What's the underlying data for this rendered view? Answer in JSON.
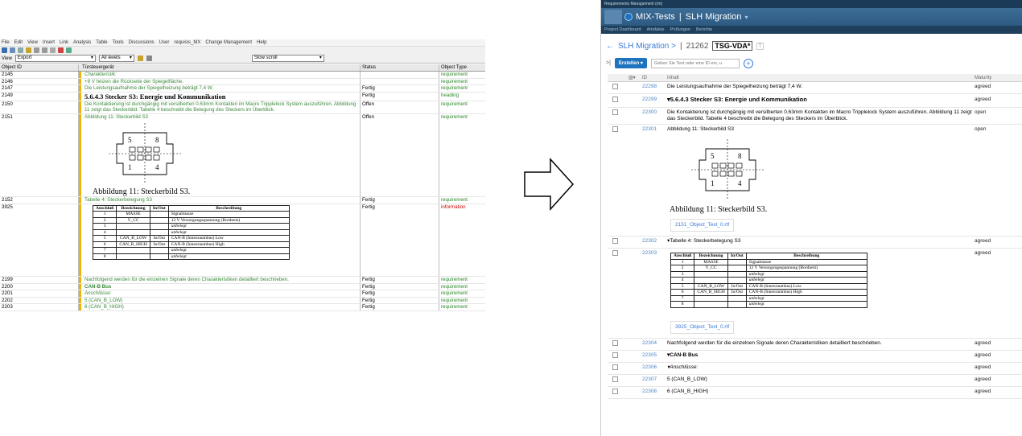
{
  "doors": {
    "menu": [
      "File",
      "Edit",
      "View",
      "Insert",
      "Link",
      "Analysis",
      "Table",
      "Tools",
      "Discussions",
      "User",
      "requisis_MX",
      "Change Management",
      "Help"
    ],
    "view_label": "View",
    "view_value": "Export",
    "levels_value": "All levels",
    "scroll_value": "Slow scroll",
    "columns": {
      "id": "Object ID",
      "main": "Türsteuergerät",
      "status": "Status",
      "type": "Object Type"
    },
    "rows": [
      {
        "id": "2145",
        "text": "Charakteristik:",
        "status": "",
        "type": "requirement",
        "style": "ital"
      },
      {
        "id": "2146",
        "text": "+8 V heizen die Rückseite der Spiegelfläche.",
        "status": "",
        "type": "requirement",
        "style": ""
      },
      {
        "id": "2147",
        "text": "Die Leistungsaufnahme der Spiegelheizung beträgt 7,4 W.",
        "status": "Fertig",
        "type": "requirement",
        "style": ""
      },
      {
        "id": "2149",
        "text": "5.6.4.3 Stecker S3: Energie und Kommunikation",
        "status": "Fertig",
        "type": "heading",
        "style": "head"
      },
      {
        "id": "2150",
        "text": "Die Kontaktierung ist durchgängig mit versilberten 0.63mm Kontakten im Macro Tripplelock System auszuführen. Abbildung 11 zeigt das Steckerbild. Tabelle 4 beschreibt die Belegung des Steckers im Überblick.",
        "status": "Offen",
        "type": "requirement",
        "style": ""
      },
      {
        "id": "2151",
        "text": "Abbildung 11: Steckerbild S3",
        "status": "Offen",
        "type": "requirement",
        "style": "figure"
      },
      {
        "id": "2152",
        "text": "Tabelle 4: Steckerbelegung S3",
        "status": "Fertig",
        "type": "requirement",
        "style": ""
      },
      {
        "id": "3925",
        "text": "",
        "status": "Fertig",
        "type": "information",
        "style": "table"
      },
      {
        "id": "2199",
        "text": "Nachfolgend werden für die einzelnen Signale deren Charakteristiken detailliert beschrieben.",
        "status": "Fertig",
        "type": "requirement",
        "style": ""
      },
      {
        "id": "2200",
        "text": "CAN-B Bus",
        "status": "Fertig",
        "type": "requirement",
        "style": "bold"
      },
      {
        "id": "2201",
        "text": "Anschlüsse:",
        "status": "Fertig",
        "type": "requirement",
        "style": "ital"
      },
      {
        "id": "2202",
        "text": "5 (CAN_B_LOW)",
        "status": "Fertig",
        "type": "requirement",
        "style": ""
      },
      {
        "id": "2203",
        "text": "6 (CAN_B_HIGH)",
        "status": "Fertig",
        "type": "requirement",
        "style": ""
      }
    ],
    "figure_caption": "Abbildung 11: Steckerbild S3."
  },
  "spec_table": {
    "headers": [
      "Anschluß",
      "Bezeichnung",
      "In/Out",
      "Beschreibung"
    ],
    "rows": [
      [
        "1",
        "MASSE",
        "",
        "Signalmasse"
      ],
      [
        "2",
        "V_CC",
        "",
        "12 V Versorgungsspannung (Bordnetz)"
      ],
      [
        "3",
        "",
        "",
        "unbelegt"
      ],
      [
        "4",
        "",
        "",
        "unbelegt"
      ],
      [
        "5",
        "CAN_B_LOW",
        "In/Out",
        "CAN-B (Innenraumbus) Low"
      ],
      [
        "6",
        "CAN_B_HIGH",
        "In/Out",
        "CAN-B (Innenraumbus) High"
      ],
      [
        "7",
        "",
        "",
        "unbelegt"
      ],
      [
        "8",
        "",
        "",
        "unbelegt"
      ]
    ]
  },
  "connector": {
    "labels": [
      "5",
      "8",
      "1",
      "4"
    ]
  },
  "rm": {
    "top_label": "Requirements Management (rm)",
    "project": "MIX-Tests",
    "module": "SLH Migration",
    "nav": [
      "Project Dashboard",
      "Artefakte",
      "Prüfungen",
      "Berichte"
    ],
    "breadcrumb": "SLH Migration >",
    "artifact_id": "21262",
    "artifact_name": "TSG-VDA*",
    "create_label": "Erstellen",
    "search_placeholder": "Geben Sie Text oder eine ID ein, u",
    "columns": {
      "id": "ID",
      "main": "Inhalt",
      "maturity": "Maturity"
    },
    "rows": [
      {
        "id": "22298",
        "text": "Die Leistungsaufnahme der Spiegelheizung beträgt 7,4 W.",
        "maturity": "agreed",
        "style": ""
      },
      {
        "id": "22299",
        "text": "▾5.6.4.3  Stecker S3: Energie und Kommunikation",
        "maturity": "agreed",
        "style": "head"
      },
      {
        "id": "22300",
        "text": "Die Kontaktierung ist durchgängig mit versilberten 0.63mm Kontakten im Macro Tripplelock System auszuführen. Abbildung 11 zeigt das Steckerbild. Tabelle 4 beschreibt die Belegung des Steckers im Überblick.",
        "maturity": "open",
        "style": ""
      },
      {
        "id": "22301",
        "text": "Abbildung 11: Steckerbild S3",
        "maturity": "open",
        "style": "figure"
      },
      {
        "id": "22302",
        "text": "▾Tabelle 4: Steckerbelegung S3",
        "maturity": "agreed",
        "style": ""
      },
      {
        "id": "22303",
        "text": "",
        "maturity": "agreed",
        "style": "table"
      },
      {
        "id": "22304",
        "text": "Nachfolgend werden für die einzelnen Signale deren Charakteristiken detailliert beschrieben.",
        "maturity": "agreed",
        "style": ""
      },
      {
        "id": "22305",
        "text": "▾CAN-B Bus",
        "maturity": "agreed",
        "style": "bold"
      },
      {
        "id": "22306",
        "text": "▾Anschlüsse:",
        "maturity": "agreed",
        "style": "ital"
      },
      {
        "id": "22307",
        "text": "5 (CAN_B_LOW)",
        "maturity": "agreed",
        "style": ""
      },
      {
        "id": "22308",
        "text": "6 (CAN_B_HIGH)",
        "maturity": "agreed",
        "style": ""
      }
    ],
    "figure_file": "2151_Object_Text_0.rtf",
    "table_file": "3925_Object_Text_0.rtf"
  }
}
